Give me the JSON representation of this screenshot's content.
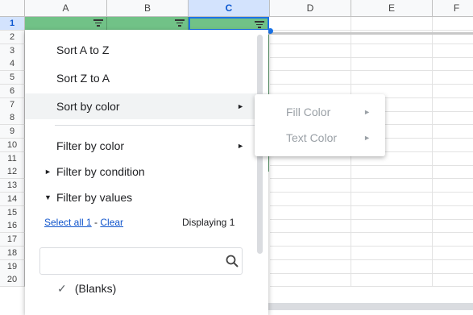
{
  "columns": [
    "A",
    "B",
    "C",
    "D",
    "E",
    "F"
  ],
  "selected_column": "C",
  "rows": [
    "1",
    "2",
    "3",
    "4",
    "5",
    "6",
    "7",
    "8",
    "9",
    "10",
    "11",
    "12",
    "13",
    "14",
    "15",
    "16",
    "17",
    "18",
    "19",
    "20"
  ],
  "menu": {
    "sort_a_z": "Sort A to Z",
    "sort_z_a": "Sort Z to A",
    "sort_by_color": "Sort by color",
    "filter_by_color": "Filter by color",
    "filter_by_condition": "Filter by condition",
    "filter_by_values": "Filter by values",
    "select_all": "Select all 1",
    "dash": " - ",
    "clear": "Clear",
    "displaying": "Displaying 1",
    "search_placeholder": "",
    "blank_value": "(Blanks)"
  },
  "submenu": {
    "fill_color": "Fill Color",
    "text_color": "Text Color"
  },
  "colors": {
    "header_green": "#71c287",
    "selection_blue": "#1a73e8",
    "link_blue": "#1155cc"
  }
}
